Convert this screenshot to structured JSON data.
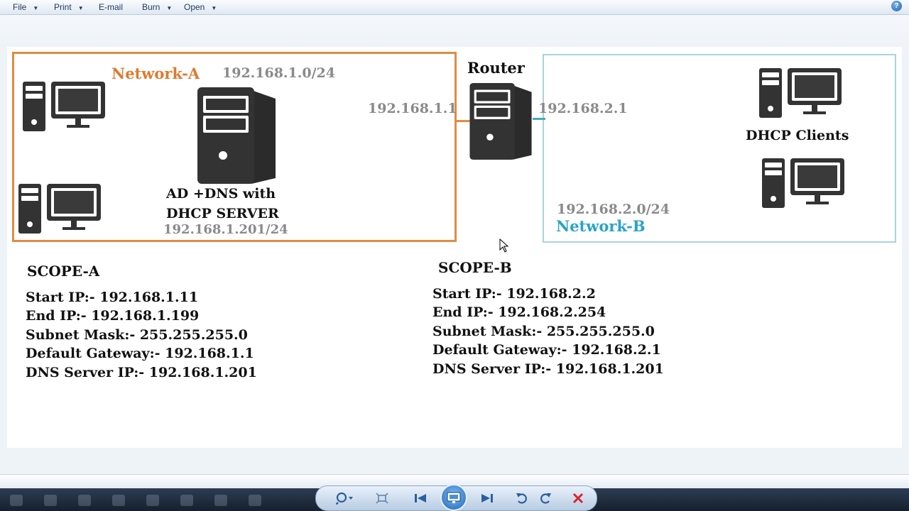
{
  "menu": {
    "file": "File",
    "print": "Print",
    "email": "E-mail",
    "burn": "Burn",
    "open": "Open",
    "arrow": "▼",
    "help": "?"
  },
  "diagram": {
    "network_a": {
      "name": "Network-A",
      "subnet": "192.168.1.0/24",
      "color": "#e07a2e"
    },
    "router": {
      "label": "Router",
      "ip_a": "192.168.1.1",
      "ip_b": "192.168.2.1"
    },
    "server": {
      "line1": "AD +DNS with",
      "line2": "DHCP SERVER",
      "ip": "192.168.1.201/24"
    },
    "network_b": {
      "name": "Network-B",
      "subnet": "192.168.2.0/24",
      "color": "#29a3c9"
    },
    "clients_label": "DHCP Clients"
  },
  "scope_a": {
    "title": "SCOPE-A",
    "lines": [
      "Start IP:- 192.168.1.11",
      "End IP:- 192.168.1.199",
      "Subnet Mask:- 255.255.255.0",
      "Default Gateway:- 192.168.1.1",
      "DNS Server IP:- 192.168.1.201"
    ]
  },
  "scope_b": {
    "title": "SCOPE-B",
    "lines": [
      "Start IP:- 192.168.2.2",
      "End IP:- 192.168.2.254",
      "Subnet Mask:- 255.255.255.0",
      "Default Gateway:- 192.168.2.1",
      "DNS Server IP:- 192.168.1.201"
    ]
  },
  "icons": {
    "workstation": "workstation-icon",
    "server": "server-icon",
    "router": "router-icon",
    "zoom": "zoom-icon",
    "fit": "fit-window-icon",
    "previous": "previous-icon",
    "slideshow": "slideshow-icon",
    "next": "next-icon",
    "rotate_ccw": "rotate-counterclockwise-icon",
    "rotate_cw": "rotate-clockwise-icon",
    "delete": "delete-icon"
  },
  "colors": {
    "network_a_border": "#e08b45",
    "network_b_border": "#a8d4dc",
    "ip_gray": "#8a8a8a",
    "icon_dark": "#333333"
  }
}
